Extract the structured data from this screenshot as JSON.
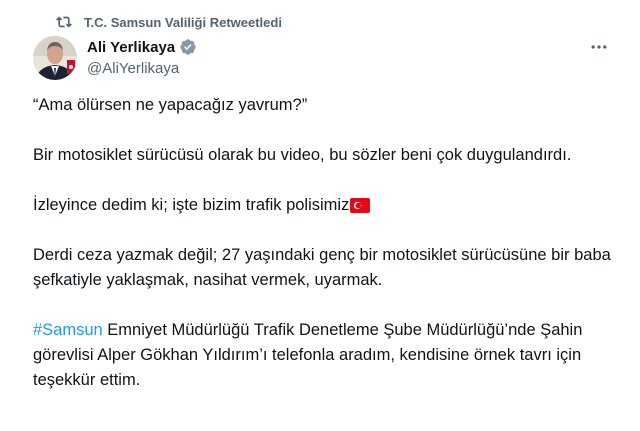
{
  "retweet": {
    "label": "T.C. Samsun Valiliği Retweetledi",
    "icon": "retweet-icon"
  },
  "author": {
    "display_name": "Ali Yerlikaya",
    "handle": "@AliYerlikaya",
    "verified_icon": "verified-badge-icon",
    "badge_color": "#829aab"
  },
  "menu": {
    "icon": "more-options-icon"
  },
  "tweet": {
    "p1": "“Ama ölürsen ne yapacağız yavrum?”",
    "p2": "Bir motosiklet sürücüsü olarak bu video, bu sözler beni çok duygulandırdı.",
    "p3": "İzleyince dedim ki; işte bizim trafik polisimiz",
    "p3_emoji": "turkey-flag-icon",
    "p4": "Derdi ceza yazmak değil; 27 yaşındaki genç bir motosiklet sürücüsüne bir baba şefkatiyle yaklaşmak, nasihat vermek, uyarmak.",
    "hashtag": "#Samsun",
    "p5_rest": " Emniyet Müdürlüğü Trafik Denetleme Şube Müdürlüğü’nde Şahin görevlisi Alper Gökhan Yıldırım’ı telefonla aradım, kendisine örnek tavrı için teşekkür ettim.",
    "link_color": "#1d9bf0"
  }
}
